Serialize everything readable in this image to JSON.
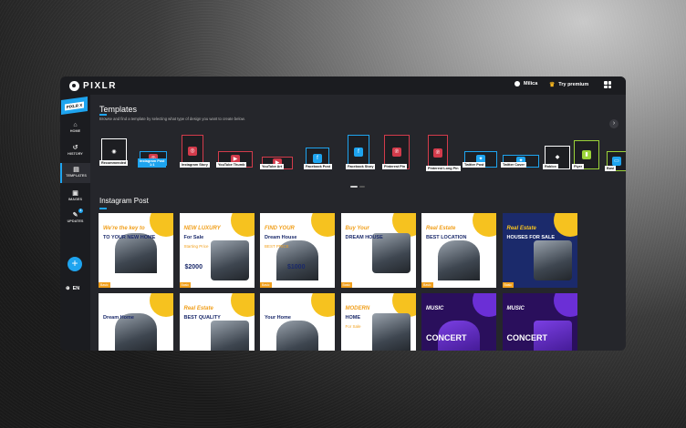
{
  "app": {
    "logo_text": "PIXLR",
    "badge": "PIXLR X"
  },
  "topbar": {
    "user_name": "Milica",
    "premium_label": "Try premium"
  },
  "sidebar": {
    "items": [
      {
        "label": "HOME",
        "icon": "home-icon"
      },
      {
        "label": "HISTORY",
        "icon": "history-icon"
      },
      {
        "label": "TEMPLATES",
        "icon": "templates-icon"
      },
      {
        "label": "IMAGES",
        "icon": "images-icon"
      },
      {
        "label": "UPDATES",
        "icon": "updates-icon",
        "count": "1"
      }
    ],
    "language": "EN"
  },
  "templates": {
    "title": "Templates",
    "subtitle": "Browse and find a template by selecting what type of design you want to create below.",
    "types": [
      {
        "label": "Recommended",
        "icon": "eye-icon",
        "color": "#ffffff"
      },
      {
        "label": "Instagram Post",
        "sublabel": "1:1",
        "icon": "instagram-icon",
        "color": "#1ea4ef"
      },
      {
        "label": "Instagram Story",
        "icon": "instagram-icon",
        "color": "#d33b4b"
      },
      {
        "label": "YouTube Thumb",
        "icon": "youtube-icon",
        "color": "#d33b4b"
      },
      {
        "label": "YouTube Art",
        "icon": "youtube-icon",
        "color": "#d33b4b"
      },
      {
        "label": "Facebook Post",
        "icon": "facebook-icon",
        "color": "#1ea4ef"
      },
      {
        "label": "Facebook Story",
        "icon": "facebook-icon",
        "color": "#1ea4ef"
      },
      {
        "label": "Pinterest Pin",
        "icon": "pinterest-icon",
        "color": "#d33b4b"
      },
      {
        "label": "Pinterest Long Pin",
        "icon": "pinterest-icon",
        "color": "#d33b4b"
      },
      {
        "label": "Twitter Post",
        "icon": "twitter-icon",
        "color": "#1ea4ef"
      },
      {
        "label": "Twitter Cover",
        "icon": "twitter-icon",
        "color": "#1ea4ef"
      },
      {
        "label": "Roblox",
        "icon": "roblox-icon",
        "color": "#ffffff"
      },
      {
        "label": "Flyer",
        "icon": "flyer-icon",
        "color": "#9bd339"
      },
      {
        "label": "Busi",
        "icon": "business-icon",
        "color": "#9bd339"
      }
    ]
  },
  "instagram_section": {
    "title": "Instagram Post",
    "cards": [
      {
        "headline": "We're the key to",
        "line2": "TO YOUR NEW HOME",
        "tag": "Basic"
      },
      {
        "headline": "NEW LUXURY",
        "line2": "For Sale",
        "line3": "Starting Price",
        "price": "$2000",
        "tag": "Basic"
      },
      {
        "headline": "FIND YOUR",
        "line2": "Dream House",
        "line3": "BEST PRICE",
        "price": "$1000",
        "tag": "Basic"
      },
      {
        "headline": "Buy Your",
        "line2": "DREAM HOUSE",
        "tag": "Basic"
      },
      {
        "headline": "Real Estate",
        "line2": "BEST LOCATION",
        "tag": "Basic"
      },
      {
        "headline": "Real Estate",
        "line2": "HOUSES FOR SALE",
        "tag": "Basic"
      },
      {
        "headline": "",
        "line2": "Dream Home",
        "tag": ""
      },
      {
        "headline": "Real Estate",
        "line2": "BEST QUALITY",
        "tag": ""
      },
      {
        "headline": "",
        "line2": "Your Home",
        "tag": ""
      },
      {
        "headline": "MODERN",
        "line2": "HOME",
        "line3": "For Sale",
        "tag": ""
      },
      {
        "headline": "MUSIC",
        "line2": "CONCERT",
        "tag": ""
      },
      {
        "headline": "MUSIC",
        "line2": "CONCERT",
        "tag": ""
      }
    ]
  }
}
